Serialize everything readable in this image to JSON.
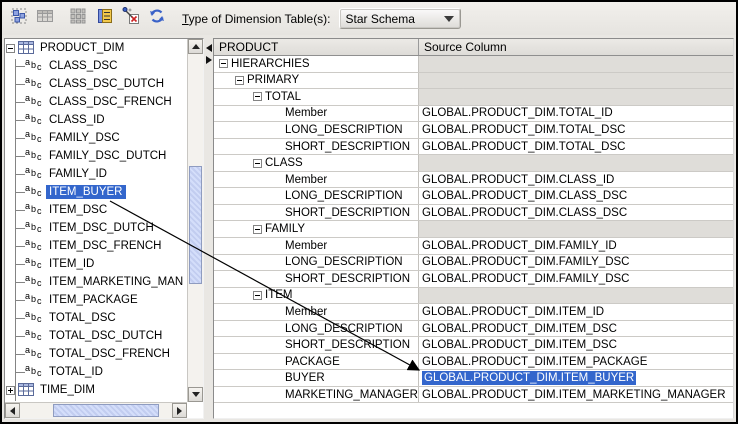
{
  "toolbar": {
    "icons": [
      {
        "name": "auto-layout-icon",
        "enabled": true
      },
      {
        "name": "table-view-icon",
        "enabled": false
      },
      {
        "name": "grid-view-icon",
        "enabled": false
      },
      {
        "name": "properties-list-icon",
        "enabled": true
      },
      {
        "name": "clear-mapping-icon",
        "enabled": true
      },
      {
        "name": "refresh-icon",
        "enabled": true
      }
    ],
    "label_mnemonic": "T",
    "label_rest": "ype of Dimension Table(s):",
    "dropdown_value": "Star Schema"
  },
  "left_tree": {
    "root_label": "PRODUCT_DIM",
    "items": [
      {
        "label": "CLASS_DSC",
        "selected": false
      },
      {
        "label": "CLASS_DSC_DUTCH",
        "selected": false
      },
      {
        "label": "CLASS_DSC_FRENCH",
        "selected": false
      },
      {
        "label": "CLASS_ID",
        "selected": false
      },
      {
        "label": "FAMILY_DSC",
        "selected": false
      },
      {
        "label": "FAMILY_DSC_DUTCH",
        "selected": false
      },
      {
        "label": "FAMILY_ID",
        "selected": false
      },
      {
        "label": "ITEM_BUYER",
        "selected": true
      },
      {
        "label": "ITEM_DSC",
        "selected": false
      },
      {
        "label": "ITEM_DSC_DUTCH",
        "selected": false
      },
      {
        "label": "ITEM_DSC_FRENCH",
        "selected": false
      },
      {
        "label": "ITEM_ID",
        "selected": false
      },
      {
        "label": "ITEM_MARKETING_MAN",
        "selected": false
      },
      {
        "label": "ITEM_PACKAGE",
        "selected": false
      },
      {
        "label": "TOTAL_DSC",
        "selected": false
      },
      {
        "label": "TOTAL_DSC_DUTCH",
        "selected": false
      },
      {
        "label": "TOTAL_DSC_FRENCH",
        "selected": false
      },
      {
        "label": "TOTAL_ID",
        "selected": false
      }
    ],
    "collapsed_root_label": "TIME_DIM"
  },
  "mapping_table": {
    "columns": [
      "PRODUCT",
      "Source Column"
    ],
    "rows": [
      {
        "label": "HIERARCHIES",
        "level": 0,
        "group": true,
        "source": "",
        "selected_source": false
      },
      {
        "label": "PRIMARY",
        "level": 1,
        "group": true,
        "source": "",
        "selected_source": false
      },
      {
        "label": "TOTAL",
        "level": 2,
        "group": true,
        "source": "",
        "selected_source": false
      },
      {
        "label": "Member",
        "level": 3,
        "group": false,
        "source": "GLOBAL.PRODUCT_DIM.TOTAL_ID",
        "selected_source": false
      },
      {
        "label": "LONG_DESCRIPTION",
        "level": 3,
        "group": false,
        "source": "GLOBAL.PRODUCT_DIM.TOTAL_DSC",
        "selected_source": false
      },
      {
        "label": "SHORT_DESCRIPTION",
        "level": 3,
        "group": false,
        "source": "GLOBAL.PRODUCT_DIM.TOTAL_DSC",
        "selected_source": false
      },
      {
        "label": "CLASS",
        "level": 2,
        "group": true,
        "source": "",
        "selected_source": false
      },
      {
        "label": "Member",
        "level": 3,
        "group": false,
        "source": "GLOBAL.PRODUCT_DIM.CLASS_ID",
        "selected_source": false
      },
      {
        "label": "LONG_DESCRIPTION",
        "level": 3,
        "group": false,
        "source": "GLOBAL.PRODUCT_DIM.CLASS_DSC",
        "selected_source": false
      },
      {
        "label": "SHORT_DESCRIPTION",
        "level": 3,
        "group": false,
        "source": "GLOBAL.PRODUCT_DIM.CLASS_DSC",
        "selected_source": false
      },
      {
        "label": "FAMILY",
        "level": 2,
        "group": true,
        "source": "",
        "selected_source": false
      },
      {
        "label": "Member",
        "level": 3,
        "group": false,
        "source": "GLOBAL.PRODUCT_DIM.FAMILY_ID",
        "selected_source": false
      },
      {
        "label": "LONG_DESCRIPTION",
        "level": 3,
        "group": false,
        "source": "GLOBAL.PRODUCT_DIM.FAMILY_DSC",
        "selected_source": false
      },
      {
        "label": "SHORT_DESCRIPTION",
        "level": 3,
        "group": false,
        "source": "GLOBAL.PRODUCT_DIM.FAMILY_DSC",
        "selected_source": false
      },
      {
        "label": "ITEM",
        "level": 2,
        "group": true,
        "source": "",
        "selected_source": false
      },
      {
        "label": "Member",
        "level": 3,
        "group": false,
        "source": "GLOBAL.PRODUCT_DIM.ITEM_ID",
        "selected_source": false
      },
      {
        "label": "LONG_DESCRIPTION",
        "level": 3,
        "group": false,
        "source": "GLOBAL.PRODUCT_DIM.ITEM_DSC",
        "selected_source": false
      },
      {
        "label": "SHORT_DESCRIPTION",
        "level": 3,
        "group": false,
        "source": "GLOBAL.PRODUCT_DIM.ITEM_DSC",
        "selected_source": false
      },
      {
        "label": "PACKAGE",
        "level": 3,
        "group": false,
        "source": "GLOBAL.PRODUCT_DIM.ITEM_PACKAGE",
        "selected_source": false
      },
      {
        "label": "BUYER",
        "level": 3,
        "group": false,
        "source": "GLOBAL.PRODUCT_DIM.ITEM_BUYER",
        "selected_source": true
      },
      {
        "label": "MARKETING_MANAGER",
        "level": 3,
        "group": false,
        "source": "GLOBAL.PRODUCT_DIM.ITEM_MARKETING_MANAGER",
        "selected_source": false
      }
    ]
  },
  "colors": {
    "selection": "#3366CC",
    "selection_text": "#ffffff",
    "group_cell_bg": "#dfddd9",
    "chrome_bg": "#e9e7e3"
  }
}
